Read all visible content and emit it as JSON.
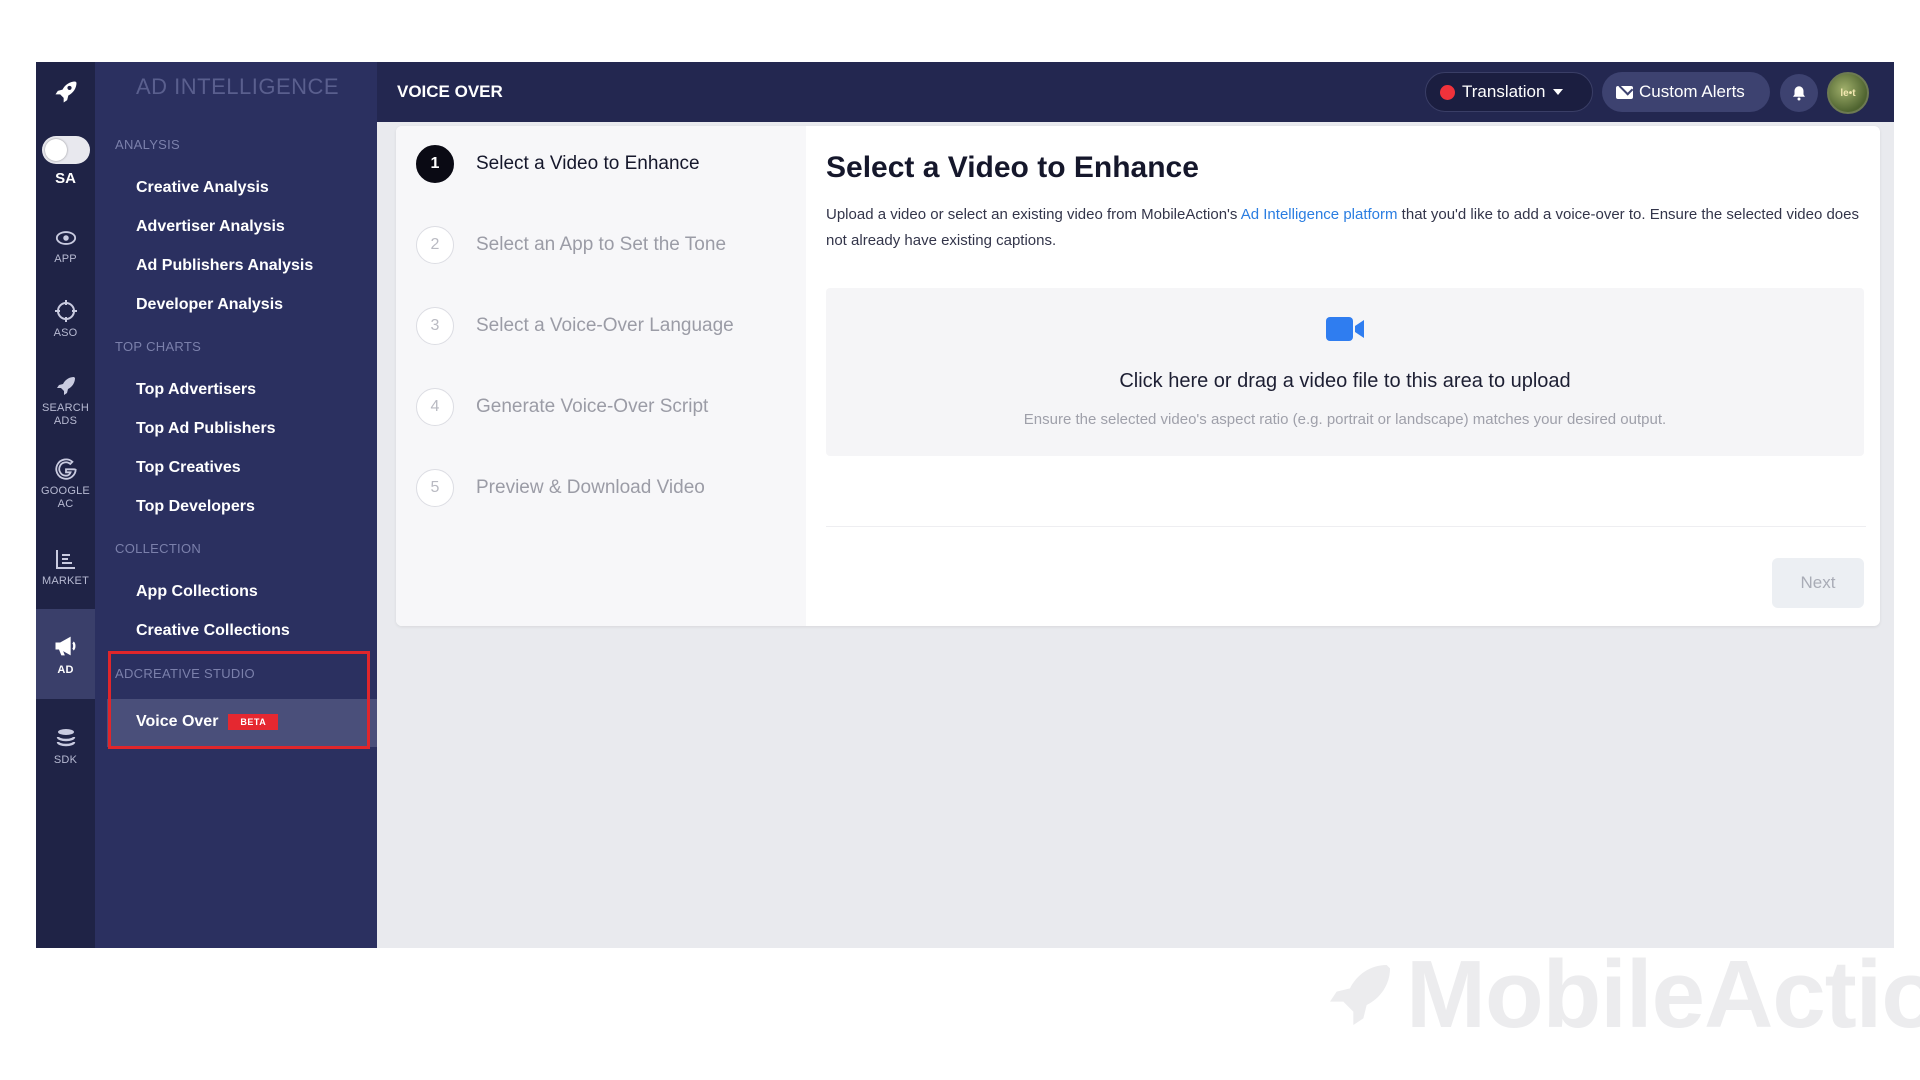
{
  "rail": {
    "toggle_label": "SA",
    "items": [
      {
        "icon": "eye-icon",
        "label": "APP"
      },
      {
        "icon": "target-icon",
        "label": "ASO"
      },
      {
        "icon": "rocket-icon",
        "label": "SEARCH ADS"
      },
      {
        "icon": "google-icon",
        "label": "GOOGLE AC"
      },
      {
        "icon": "bar-chart-icon",
        "label": "MARKET"
      },
      {
        "icon": "megaphone-icon",
        "label": "AD",
        "active": true
      },
      {
        "icon": "layers-icon",
        "label": "SDK"
      }
    ]
  },
  "nav": {
    "brand": "AD INTELLIGENCE",
    "sections": [
      {
        "title": "ANALYSIS",
        "items": [
          "Creative Analysis",
          "Advertiser Analysis",
          "Ad Publishers Analysis",
          "Developer Analysis"
        ]
      },
      {
        "title": "TOP CHARTS",
        "items": [
          "Top Advertisers",
          "Top Ad Publishers",
          "Top Creatives",
          "Top Developers"
        ]
      },
      {
        "title": "COLLECTION",
        "items": [
          "App Collections",
          "Creative Collections"
        ]
      },
      {
        "title": "ADCREATIVE STUDIO",
        "items": [
          "Voice Over"
        ]
      }
    ],
    "beta_badge": "BETA"
  },
  "topbar": {
    "page_title": "VOICE OVER",
    "translation_label": "Translation",
    "alerts_label": "Custom Alerts",
    "avatar_text": "le•t"
  },
  "steps": [
    {
      "num": "1",
      "label": "Select a Video to Enhance",
      "current": true
    },
    {
      "num": "2",
      "label": "Select an App to Set the Tone"
    },
    {
      "num": "3",
      "label": "Select a Voice-Over Language"
    },
    {
      "num": "4",
      "label": "Generate Voice-Over Script"
    },
    {
      "num": "5",
      "label": "Preview & Download Video"
    }
  ],
  "content": {
    "title": "Select a Video to Enhance",
    "desc_before": "Upload a video or select an existing video from MobileAction's ",
    "desc_link": "Ad Intelligence platform",
    "desc_after": " that you'd like to add a voice-over to. Ensure the selected video does not already have existing captions.",
    "upload_main": "Click here or drag a video file to this area to upload",
    "upload_sub": "Ensure the selected video's aspect ratio (e.g. portrait or landscape) matches your desired output.",
    "next_label": "Next"
  },
  "watermark": "MobileAction",
  "colors": {
    "sidebar": "#2b3060",
    "rail": "#1f2346",
    "accent_link": "#2a7de1",
    "beta": "#e52830",
    "highlight": "#e0262b"
  }
}
